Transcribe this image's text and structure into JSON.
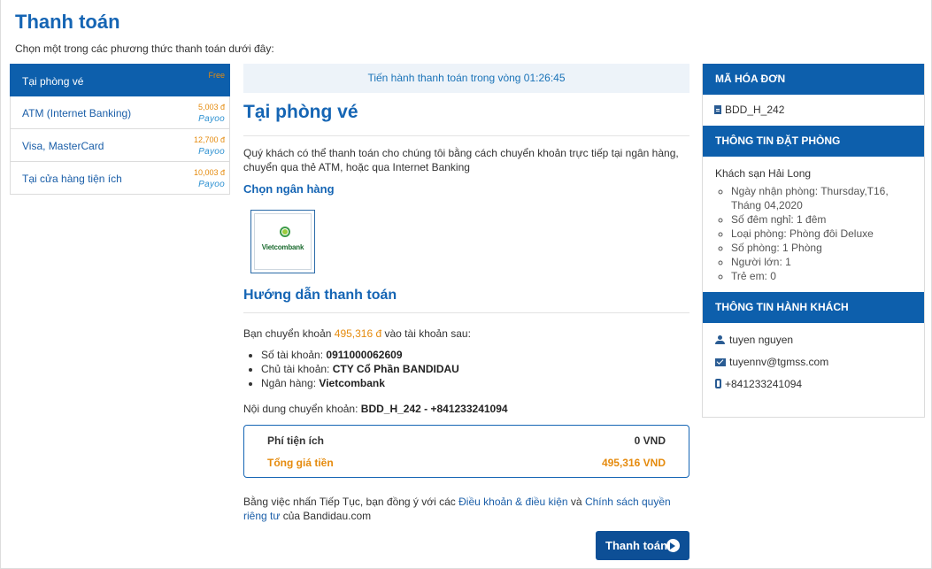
{
  "page": {
    "title": "Thanh toán",
    "subtitle": "Chọn một trong các phương thức thanh toán dưới đây:"
  },
  "methods": [
    {
      "label": "Tại phòng vé",
      "fee": "Free",
      "active": true
    },
    {
      "label": "ATM (Internet Banking)",
      "fee": "5,003 đ",
      "brand": "Payoo"
    },
    {
      "label": "Visa, MasterCard",
      "fee": "12,700 đ",
      "brand": "Payoo"
    },
    {
      "label": "Tại cửa hàng tiện ích",
      "fee": "10,003 đ",
      "brand": "Payoo"
    }
  ],
  "main": {
    "timer_text": "Tiến hành thanh toán trong vòng 01:26:45",
    "heading": "Tại phòng vé",
    "description": "Quý khách có thể thanh toán cho chúng tôi bằng cách chuyển khoản trực tiếp tại ngân hàng, chuyển qua thẻ ATM, hoặc qua Internet Banking",
    "choose_bank": "Chọn ngân hàng",
    "bank_logo_text": "Vietcombank",
    "guide_heading": "Hướng dẫn thanh toán",
    "transfer_prefix": "Bạn chuyển khoản",
    "transfer_amount": "495,316 đ",
    "transfer_suffix": "vào tài khoản sau:",
    "account_number_label": "Số tài khoản:",
    "account_number": "0911000062609",
    "account_holder_label": "Chủ tài khoản:",
    "account_holder": "CTY Cổ Phần BANDIDAU",
    "bank_label": "Ngân hàng:",
    "bank_name": "Vietcombank",
    "content_label": "Nội dung chuyển khoản:",
    "content_value": "BDD_H_242 - +841233241094",
    "fee_label": "Phí tiện ích",
    "fee_value": "0 VND",
    "total_label": "Tổng giá tiền",
    "total_value": "495,316 VND",
    "terms_prefix": "Bằng việc nhấn Tiếp Tục, bạn đồng ý với các",
    "terms_link": "Điều khoản & điều kiện",
    "terms_and": "và",
    "privacy_link": "Chính sách quyền riêng tư",
    "terms_suffix": "của Bandidau.com",
    "pay_button": "Thanh toán"
  },
  "sidebar": {
    "invoice_title": "MÃ HÓA ĐƠN",
    "invoice_code": "BDD_H_242",
    "booking_title": "THÔNG TIN ĐẶT PHÒNG",
    "hotel_name": "Khách sạn Hải Long",
    "booking_items": [
      "Ngày nhận phòng: Thursday,T16, Tháng 04,2020",
      "Số đêm nghỉ: 1 đêm",
      "Loại phòng: Phòng đôi Deluxe",
      "Số phòng: 1 Phòng",
      "Người lớn: 1",
      "Trẻ em: 0"
    ],
    "guest_title": "THÔNG TIN HÀNH KHÁCH",
    "guest_name": "tuyen nguyen",
    "guest_email": "tuyennv@tgmss.com",
    "guest_phone": "+841233241094"
  },
  "colors": {
    "primary": "#1565b4",
    "active_bg": "#0d5fac",
    "accent_orange": "#e58b0e"
  }
}
